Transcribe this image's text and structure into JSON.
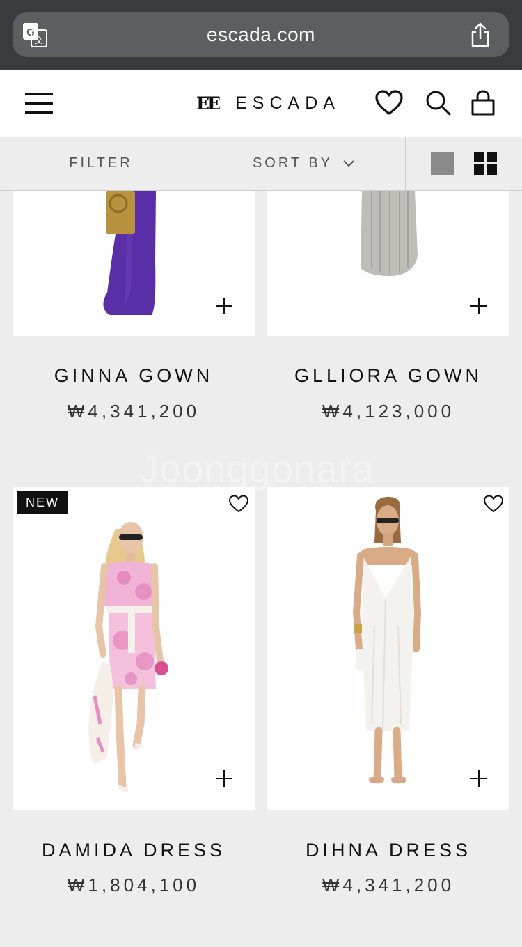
{
  "browser": {
    "url": "escada.com"
  },
  "header": {
    "logo_text": "ESCADA",
    "logo_mark": "EE"
  },
  "toolbar": {
    "filter_label": "FILTER",
    "sort_label": "SORT BY"
  },
  "products": [
    {
      "name": "GINNA GOWN",
      "price": "₩4,341,200"
    },
    {
      "name": "GLLIORA GOWN",
      "price": "₩4,123,000"
    },
    {
      "name": "DAMIDA DRESS",
      "price": "₩1,804,100",
      "badge": "NEW"
    },
    {
      "name": "DIHNA DRESS",
      "price": "₩4,341,200"
    }
  ],
  "watermark": "Joonggonara",
  "colors": {
    "browser_bar": "#3a3b3d",
    "url_pill": "#5c5e61",
    "page_bg": "#ededed",
    "accent": "#111111"
  }
}
